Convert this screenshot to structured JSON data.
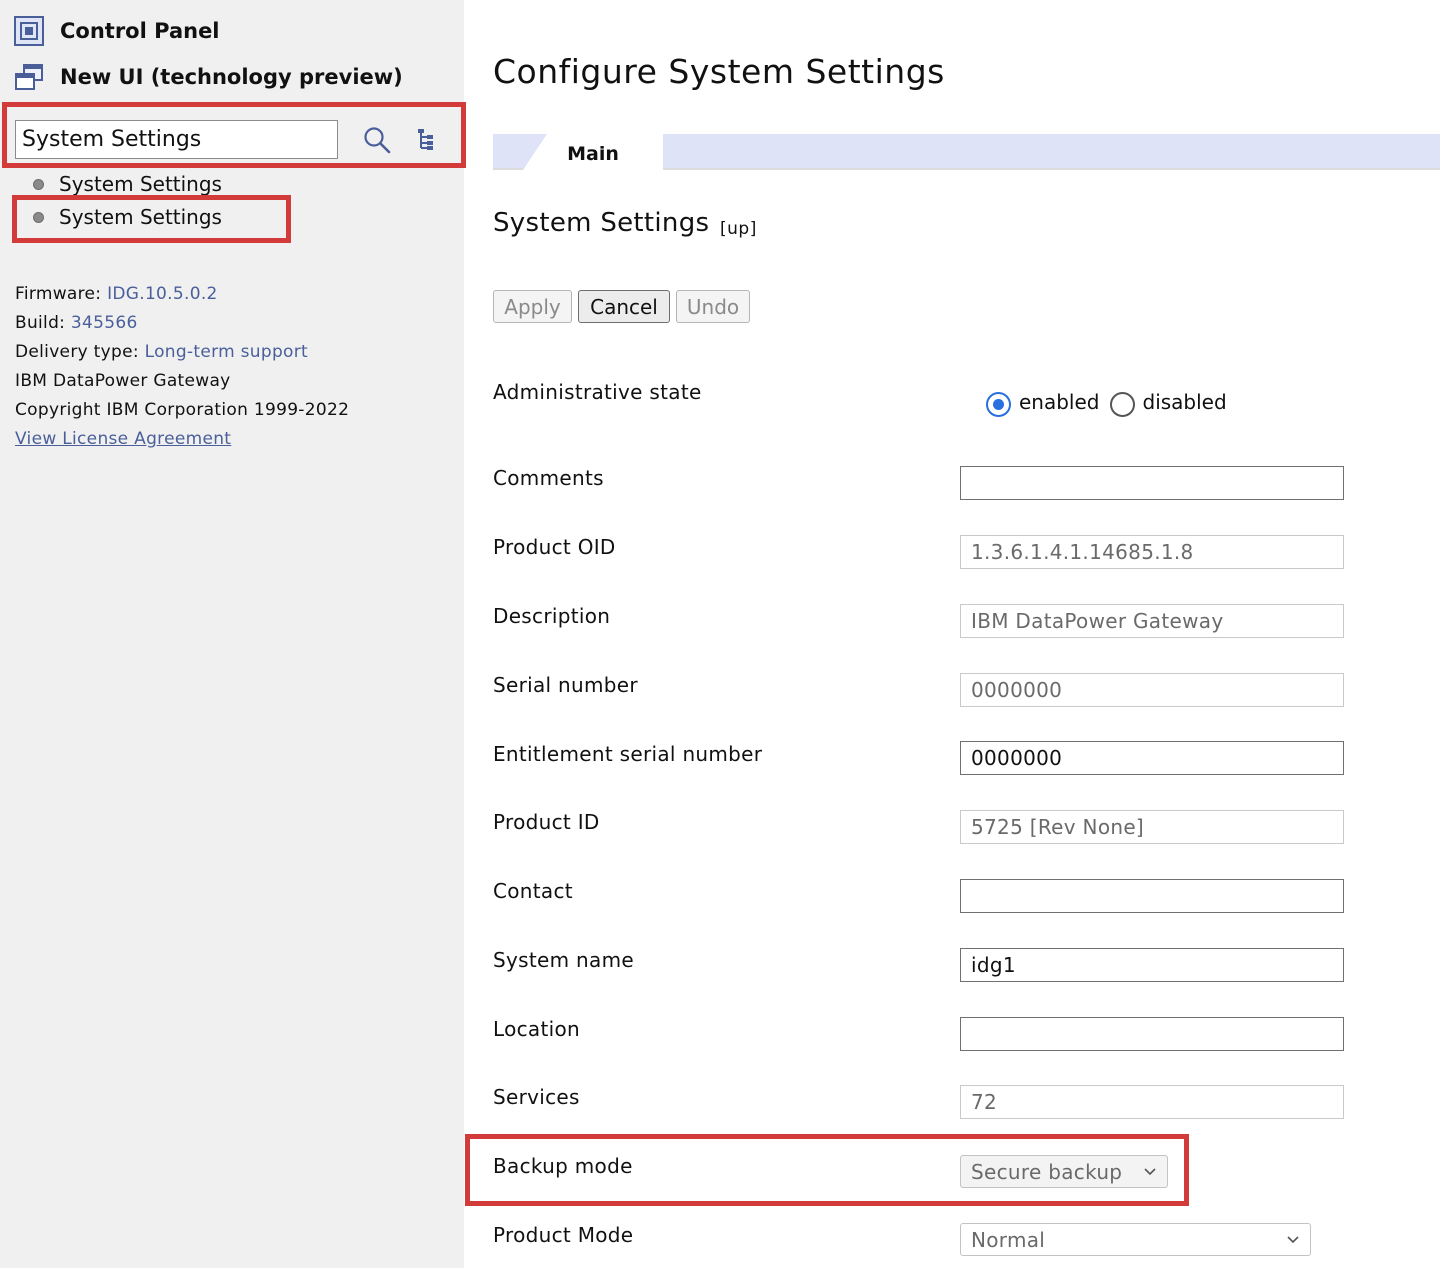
{
  "sidebar": {
    "control_panel": "Control Panel",
    "new_ui": "New UI (technology preview)",
    "search_value": "System Settings",
    "results": [
      "System Settings",
      "System Settings"
    ],
    "firmware_label": "Firmware:",
    "firmware_value": "IDG.10.5.0.2",
    "build_label": "Build:",
    "build_value": "345566",
    "delivery_label": "Delivery type:",
    "delivery_value": "Long-term support",
    "product": "IBM DataPower Gateway",
    "copyright": "Copyright IBM Corporation 1999-2022",
    "license_link": "View License Agreement"
  },
  "main": {
    "title": "Configure System Settings",
    "tab": "Main",
    "section_title": "System Settings",
    "section_up": "[up]",
    "buttons": {
      "apply": "Apply",
      "cancel": "Cancel",
      "undo": "Undo"
    },
    "admin_state": {
      "label": "Administrative state",
      "enabled": "enabled",
      "disabled": "disabled",
      "selected": "enabled"
    },
    "fields": {
      "comments": {
        "label": "Comments",
        "value": ""
      },
      "product_oid": {
        "label": "Product OID",
        "value": "1.3.6.1.4.1.14685.1.8"
      },
      "description": {
        "label": "Description",
        "value": "IBM DataPower Gateway"
      },
      "serial_number": {
        "label": "Serial number",
        "value": "0000000"
      },
      "entitlement_serial": {
        "label": "Entitlement serial number",
        "value": "0000000"
      },
      "product_id": {
        "label": "Product ID",
        "value": "5725 [Rev None]"
      },
      "contact": {
        "label": "Contact",
        "value": ""
      },
      "system_name": {
        "label": "System name",
        "value": "idg1"
      },
      "location": {
        "label": "Location",
        "value": ""
      },
      "services": {
        "label": "Services",
        "value": "72"
      }
    },
    "backup_mode": {
      "label": "Backup mode",
      "value": "Secure backup"
    },
    "product_mode": {
      "label": "Product Mode",
      "value": "Normal"
    }
  },
  "colors": {
    "highlight": "#d33a3a",
    "link": "#4a5f9a",
    "tab_bar": "#dfe3f7",
    "radio": "#2a6fe0"
  }
}
